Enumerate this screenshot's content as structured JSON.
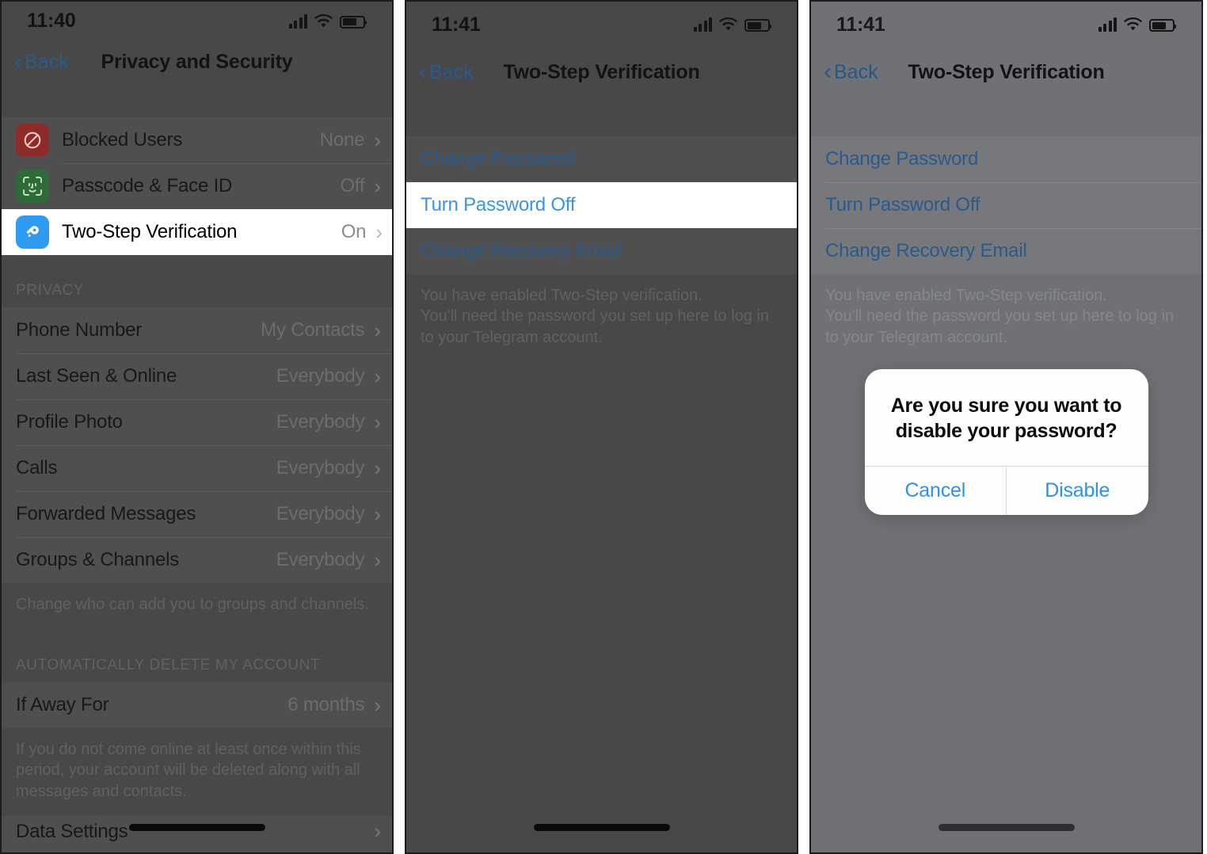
{
  "panels": [
    {
      "id": "privacy-and-security",
      "status": {
        "time": "11:40",
        "signal_icon": "cellular-signal-icon",
        "wifi_icon": "wifi-icon",
        "battery_icon": "battery-icon"
      },
      "nav": {
        "back_label": "Back",
        "title": "Privacy and Security",
        "back_icon": "chevron-left-icon"
      },
      "security_rows": [
        {
          "icon": "block-icon",
          "label": "Blocked Users",
          "value": "None",
          "highlight": false
        },
        {
          "icon": "face-id-icon",
          "label": "Passcode & Face ID",
          "value": "Off",
          "highlight": false
        },
        {
          "icon": "key-icon",
          "label": "Two-Step Verification",
          "value": "On",
          "highlight": true
        }
      ],
      "privacy_header": "PRIVACY",
      "privacy_rows": [
        {
          "label": "Phone Number",
          "value": "My Contacts"
        },
        {
          "label": "Last Seen & Online",
          "value": "Everybody"
        },
        {
          "label": "Profile Photo",
          "value": "Everybody"
        },
        {
          "label": "Calls",
          "value": "Everybody"
        },
        {
          "label": "Forwarded Messages",
          "value": "Everybody"
        },
        {
          "label": "Groups & Channels",
          "value": "Everybody"
        }
      ],
      "privacy_footnote": "Change who can add you to groups and channels.",
      "delete_header": "AUTOMATICALLY DELETE MY ACCOUNT",
      "delete_row": {
        "label": "If Away For",
        "value": "6 months"
      },
      "delete_footnote": "If you do not come online at least once within this period, your account will be deleted along with all messages and contacts.",
      "last_row": {
        "label": "Data Settings"
      }
    },
    {
      "id": "two-step-verification",
      "status": {
        "time": "11:41",
        "signal_icon": "cellular-signal-icon",
        "wifi_icon": "wifi-icon",
        "battery_icon": "battery-icon"
      },
      "nav": {
        "back_label": "Back",
        "title": "Two-Step Verification",
        "back_icon": "chevron-left-icon"
      },
      "links": [
        {
          "label": "Change Password",
          "highlight": false
        },
        {
          "label": "Turn Password Off",
          "highlight": true
        },
        {
          "label": "Change Recovery Email",
          "highlight": false
        }
      ],
      "footnote": "You have enabled Two-Step verification.\nYou'll need the password you set up here to log in to your Telegram account."
    },
    {
      "id": "two-step-verification-alert",
      "status": {
        "time": "11:41",
        "signal_icon": "cellular-signal-icon",
        "wifi_icon": "wifi-icon",
        "battery_icon": "battery-icon"
      },
      "nav": {
        "back_label": "Back",
        "title": "Two-Step Verification",
        "back_icon": "chevron-left-icon"
      },
      "links": [
        {
          "label": "Change Password",
          "highlight": false
        },
        {
          "label": "Turn Password Off",
          "highlight": false
        },
        {
          "label": "Change Recovery Email",
          "highlight": false
        }
      ],
      "footnote": "You have enabled Two-Step verification.\nYou'll need the password you set up here to log in to your Telegram account.",
      "alert": {
        "title": "Are you sure you want to disable your password?",
        "cancel_label": "Cancel",
        "confirm_label": "Disable"
      }
    }
  ],
  "colors": {
    "accent_blue": "#3b93e8",
    "link_blue_dim": "#2a5a8c",
    "blocked_red": "#d7342e",
    "faceid_green": "#34a853",
    "key_blue": "#2f9bf0",
    "panel_dim_bg": "#484848",
    "panel_light_bg": "#6f7175",
    "highlight_bg": "#ffffff"
  }
}
